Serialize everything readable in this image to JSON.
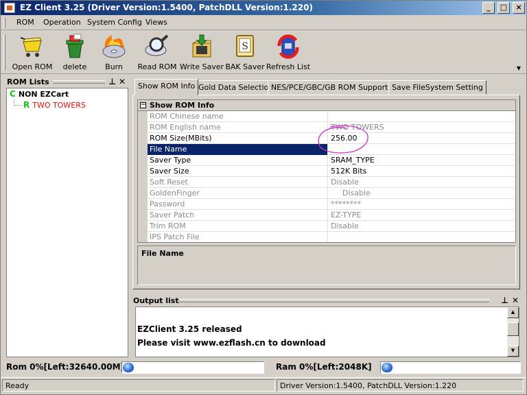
{
  "window": {
    "title": "EZ Client 3.25 (Driver Version:1.5400, PatchDLL Version:1.220)",
    "controls": [
      "minimize",
      "maximize",
      "close"
    ]
  },
  "menu": [
    "ROM",
    "Operation",
    "System Config",
    "Views"
  ],
  "toolbar": [
    {
      "label": "Open ROM",
      "icon": "cart-icon"
    },
    {
      "label": "delete",
      "icon": "trash-icon"
    },
    {
      "label": "Burn",
      "icon": "burn-disc-icon"
    },
    {
      "label": "Read ROM",
      "icon": "magnifier-icon"
    },
    {
      "label": "Write Saver",
      "icon": "write-folder-icon"
    },
    {
      "label": "BAK Saver",
      "icon": "save-s-icon"
    },
    {
      "label": "Refresh List",
      "icon": "refresh-icon"
    }
  ],
  "rom_lists": {
    "title": "ROM Lists",
    "items": [
      {
        "letter": "C",
        "label": "NON EZCart",
        "color": "#000000"
      },
      {
        "letter": "R",
        "label": "TWO TOWERS",
        "color": "#e01010"
      }
    ]
  },
  "tabs": [
    "Show ROM Info",
    "Gold Data Selection",
    "NES/PCE/GBC/GB ROM Support",
    "Save FileSystem Setting"
  ],
  "active_tab": "Show ROM Info",
  "rom_info": {
    "header": "Show ROM Info",
    "rows": [
      {
        "name": "ROM Chinese name",
        "value": ""
      },
      {
        "name": "ROM English name",
        "value": "TWO TOWERS"
      },
      {
        "name": "ROM Size(MBits)",
        "value": "256.00"
      },
      {
        "name": "File Name",
        "value": ""
      },
      {
        "name": "Saver Type",
        "value": "SRAM_TYPE"
      },
      {
        "name": "Saver Size",
        "value": "512K Bits"
      },
      {
        "name": "Soft Reset",
        "value": "Disable"
      },
      {
        "name": "GoldenFinger",
        "value": "Disable"
      },
      {
        "name": "Password",
        "value": "********"
      },
      {
        "name": "Saver Patch",
        "value": "EZ-TYPE"
      },
      {
        "name": "Trim ROM",
        "value": "Disable"
      },
      {
        "name": "IPS Patch File",
        "value": ""
      }
    ],
    "description_title": "File Name"
  },
  "output": {
    "title": "Output list",
    "lines": [
      "EZClient 3.25 released",
      "Please visit www.ezflash.cn to download"
    ]
  },
  "progress": {
    "rom_label": "Rom  0%[Left:32640.00M]",
    "rom_percent": 0,
    "ram_label": "Ram  0%[Left:2048K]",
    "ram_percent": 0
  },
  "status": {
    "ready": "Ready",
    "driver": "Driver Version:1.5400, PatchDLL Version:1.220"
  },
  "colors": {
    "titlebar": "#0a246a",
    "face": "#d4d0c8",
    "selection": "#0a246a",
    "annotation": "#cc33cc"
  }
}
